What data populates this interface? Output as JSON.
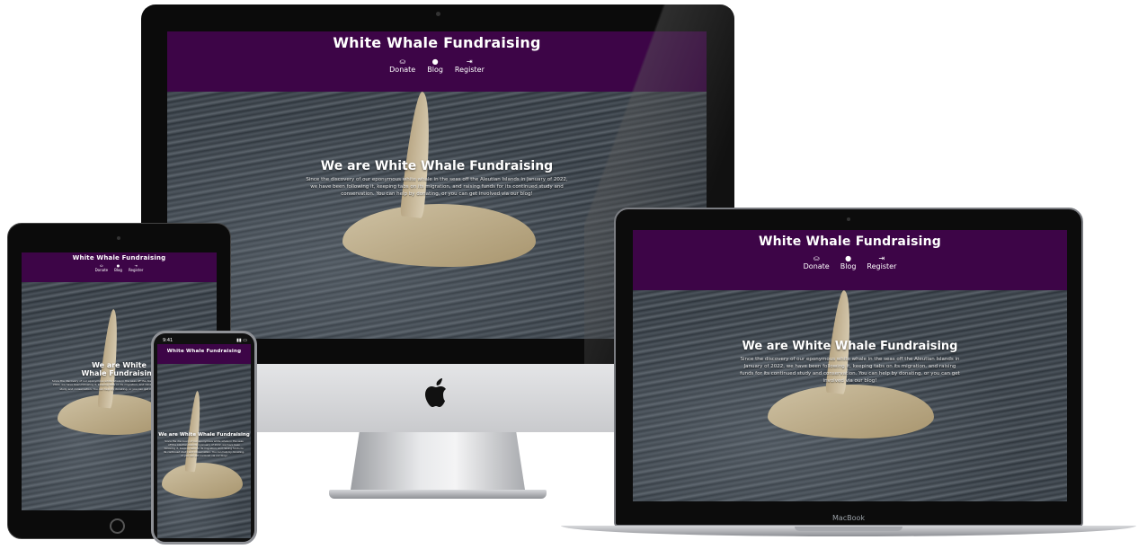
{
  "site": {
    "brand": "White Whale Fundraising",
    "nav": [
      {
        "label": "Donate",
        "icon": "donate-hand-icon",
        "glyph": "⛀"
      },
      {
        "label": "Blog",
        "icon": "comment-icon",
        "glyph": "●"
      },
      {
        "label": "Register",
        "icon": "sign-in-icon",
        "glyph": "⇥"
      }
    ],
    "hero_title": "We are White Whale Fundraising",
    "hero_body": "Since the discovery of our eponymous white whale in the seas off the Aleutian Islands in January of 2022, we have been following it, keeping tabs on its migration, and raising funds for its continued study and conservation. You can help by donating, or you can get involved via our blog!"
  },
  "devices": {
    "macbook_label": "MacBook",
    "iphone_time": "9:41"
  },
  "colors": {
    "header_purple": "#3d0547",
    "hero_text": "#ffffff"
  }
}
